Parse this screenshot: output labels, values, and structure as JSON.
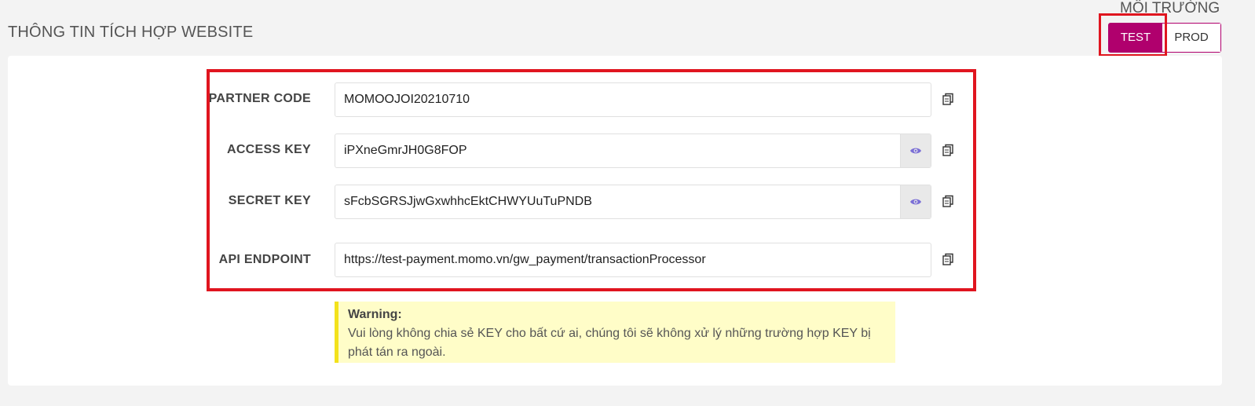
{
  "page_title": "THÔNG TIN TÍCH HỢP WEBSITE",
  "environment": {
    "label": "MÔI TRƯỜNG",
    "options": [
      "TEST",
      "PROD"
    ],
    "selected": "TEST",
    "accent_color": "#b0006d"
  },
  "fields": [
    {
      "label": "PARTNER CODE",
      "value": "MOMOOJOI20210710",
      "has_reveal": false
    },
    {
      "label": "ACCESS KEY",
      "value": "iPXneGmrJH0G8FOP",
      "has_reveal": true
    },
    {
      "label": "SECRET KEY",
      "value": "sFcbSGRSJjwGxwhhcEktCHWYUuTuPNDB",
      "has_reveal": true
    },
    {
      "label": "API ENDPOINT",
      "value": "https://test-payment.momo.vn/gw_payment/transactionProcessor",
      "has_reveal": false
    }
  ],
  "icons": {
    "copy": "copy-icon",
    "reveal": "eye-icon"
  },
  "warning": {
    "title": "Warning:",
    "message": "Vui lòng không chia sẻ KEY cho bất cứ ai, chúng tôi sẽ không xử lý những trường hợp KEY bị phát tán ra ngoài."
  },
  "annotation_color": "#e0151f"
}
